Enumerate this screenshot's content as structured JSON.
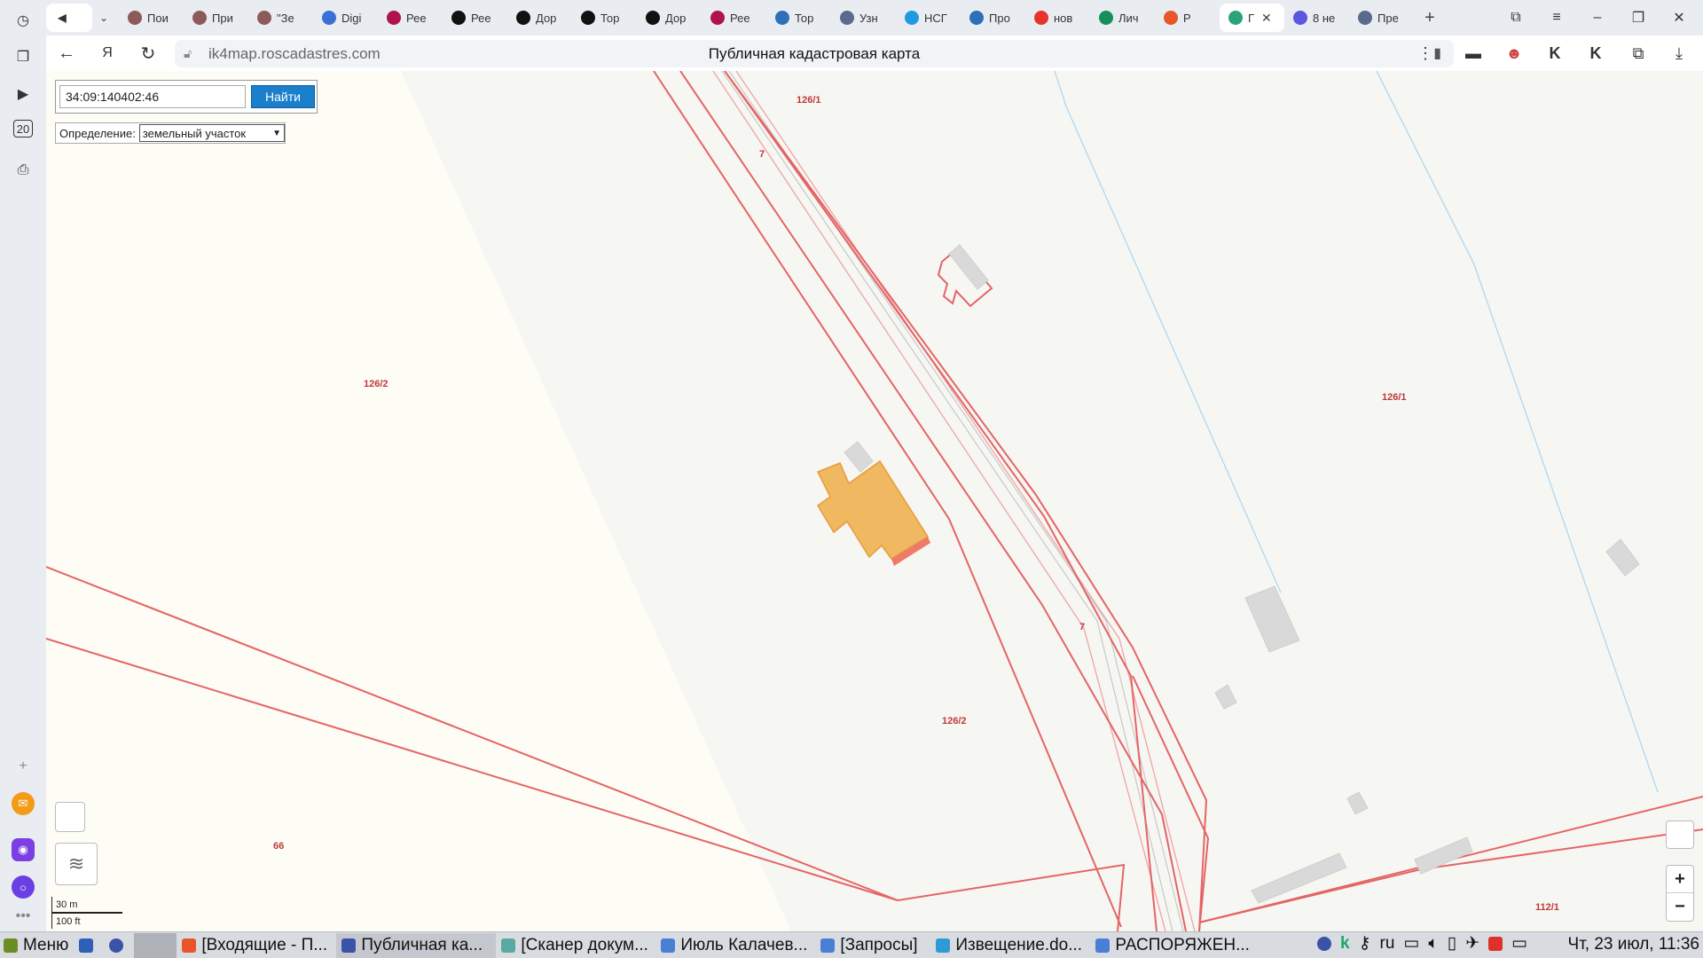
{
  "browser": {
    "tabs": [
      {
        "label": "Пои",
        "color": "#8c5a5a"
      },
      {
        "label": "При",
        "color": "#8c5a5a"
      },
      {
        "label": "\"Зе",
        "color": "#8c5a5a"
      },
      {
        "label": "Digi",
        "color": "#3b6fd6"
      },
      {
        "label": "Рее",
        "color": "#b0124f"
      },
      {
        "label": "Рее",
        "color": "#111111"
      },
      {
        "label": "Дор",
        "color": "#111111"
      },
      {
        "label": "Тор",
        "color": "#111111"
      },
      {
        "label": "Дор",
        "color": "#111111"
      },
      {
        "label": "Рее",
        "color": "#b0124f"
      },
      {
        "label": "Тор",
        "color": "#2d6fb8"
      },
      {
        "label": "Узн",
        "color": "#5a6a8c"
      },
      {
        "label": "НСГ",
        "color": "#1e9be0"
      },
      {
        "label": "Про",
        "color": "#2d6fb8"
      },
      {
        "label": "нов",
        "color": "#e8332b"
      },
      {
        "label": "Лич",
        "color": "#168f5a"
      },
      {
        "label": "Р",
        "color": "#e8552b"
      },
      {
        "label": "Г",
        "color": "#2aa37b"
      },
      {
        "label": "8 не",
        "color": "#5c56e0"
      },
      {
        "label": "Пре",
        "color": "#5a6a8c"
      }
    ],
    "url": "ik4map.roscadastres.com",
    "page_title": "Публичная кадастровая карта"
  },
  "search": {
    "value": "34:09:140402:46",
    "button": "Найти",
    "definition_label": "Определение:",
    "definition_value": "земельный участок"
  },
  "map": {
    "labels": {
      "l1": "126/1",
      "l2": "126/2",
      "l3": "126/1",
      "l4": "126/2",
      "l5": "66",
      "l6": "112/1",
      "l7": "7",
      "l8": "7"
    },
    "scale_metric": "30 m",
    "scale_imperial": "100 ft",
    "zoom_in": "+",
    "zoom_out": "−"
  },
  "taskbar": {
    "menu": "Меню",
    "items": [
      "[Входящие - П...",
      "Публичная ка...",
      "[Сканер докум...",
      "Июль Калачев...",
      "[Запросы]",
      "Извещение.do...",
      "РАСПОРЯЖЕН..."
    ],
    "lang": "ru",
    "clock": "Чт, 23 июл, 11:36"
  }
}
